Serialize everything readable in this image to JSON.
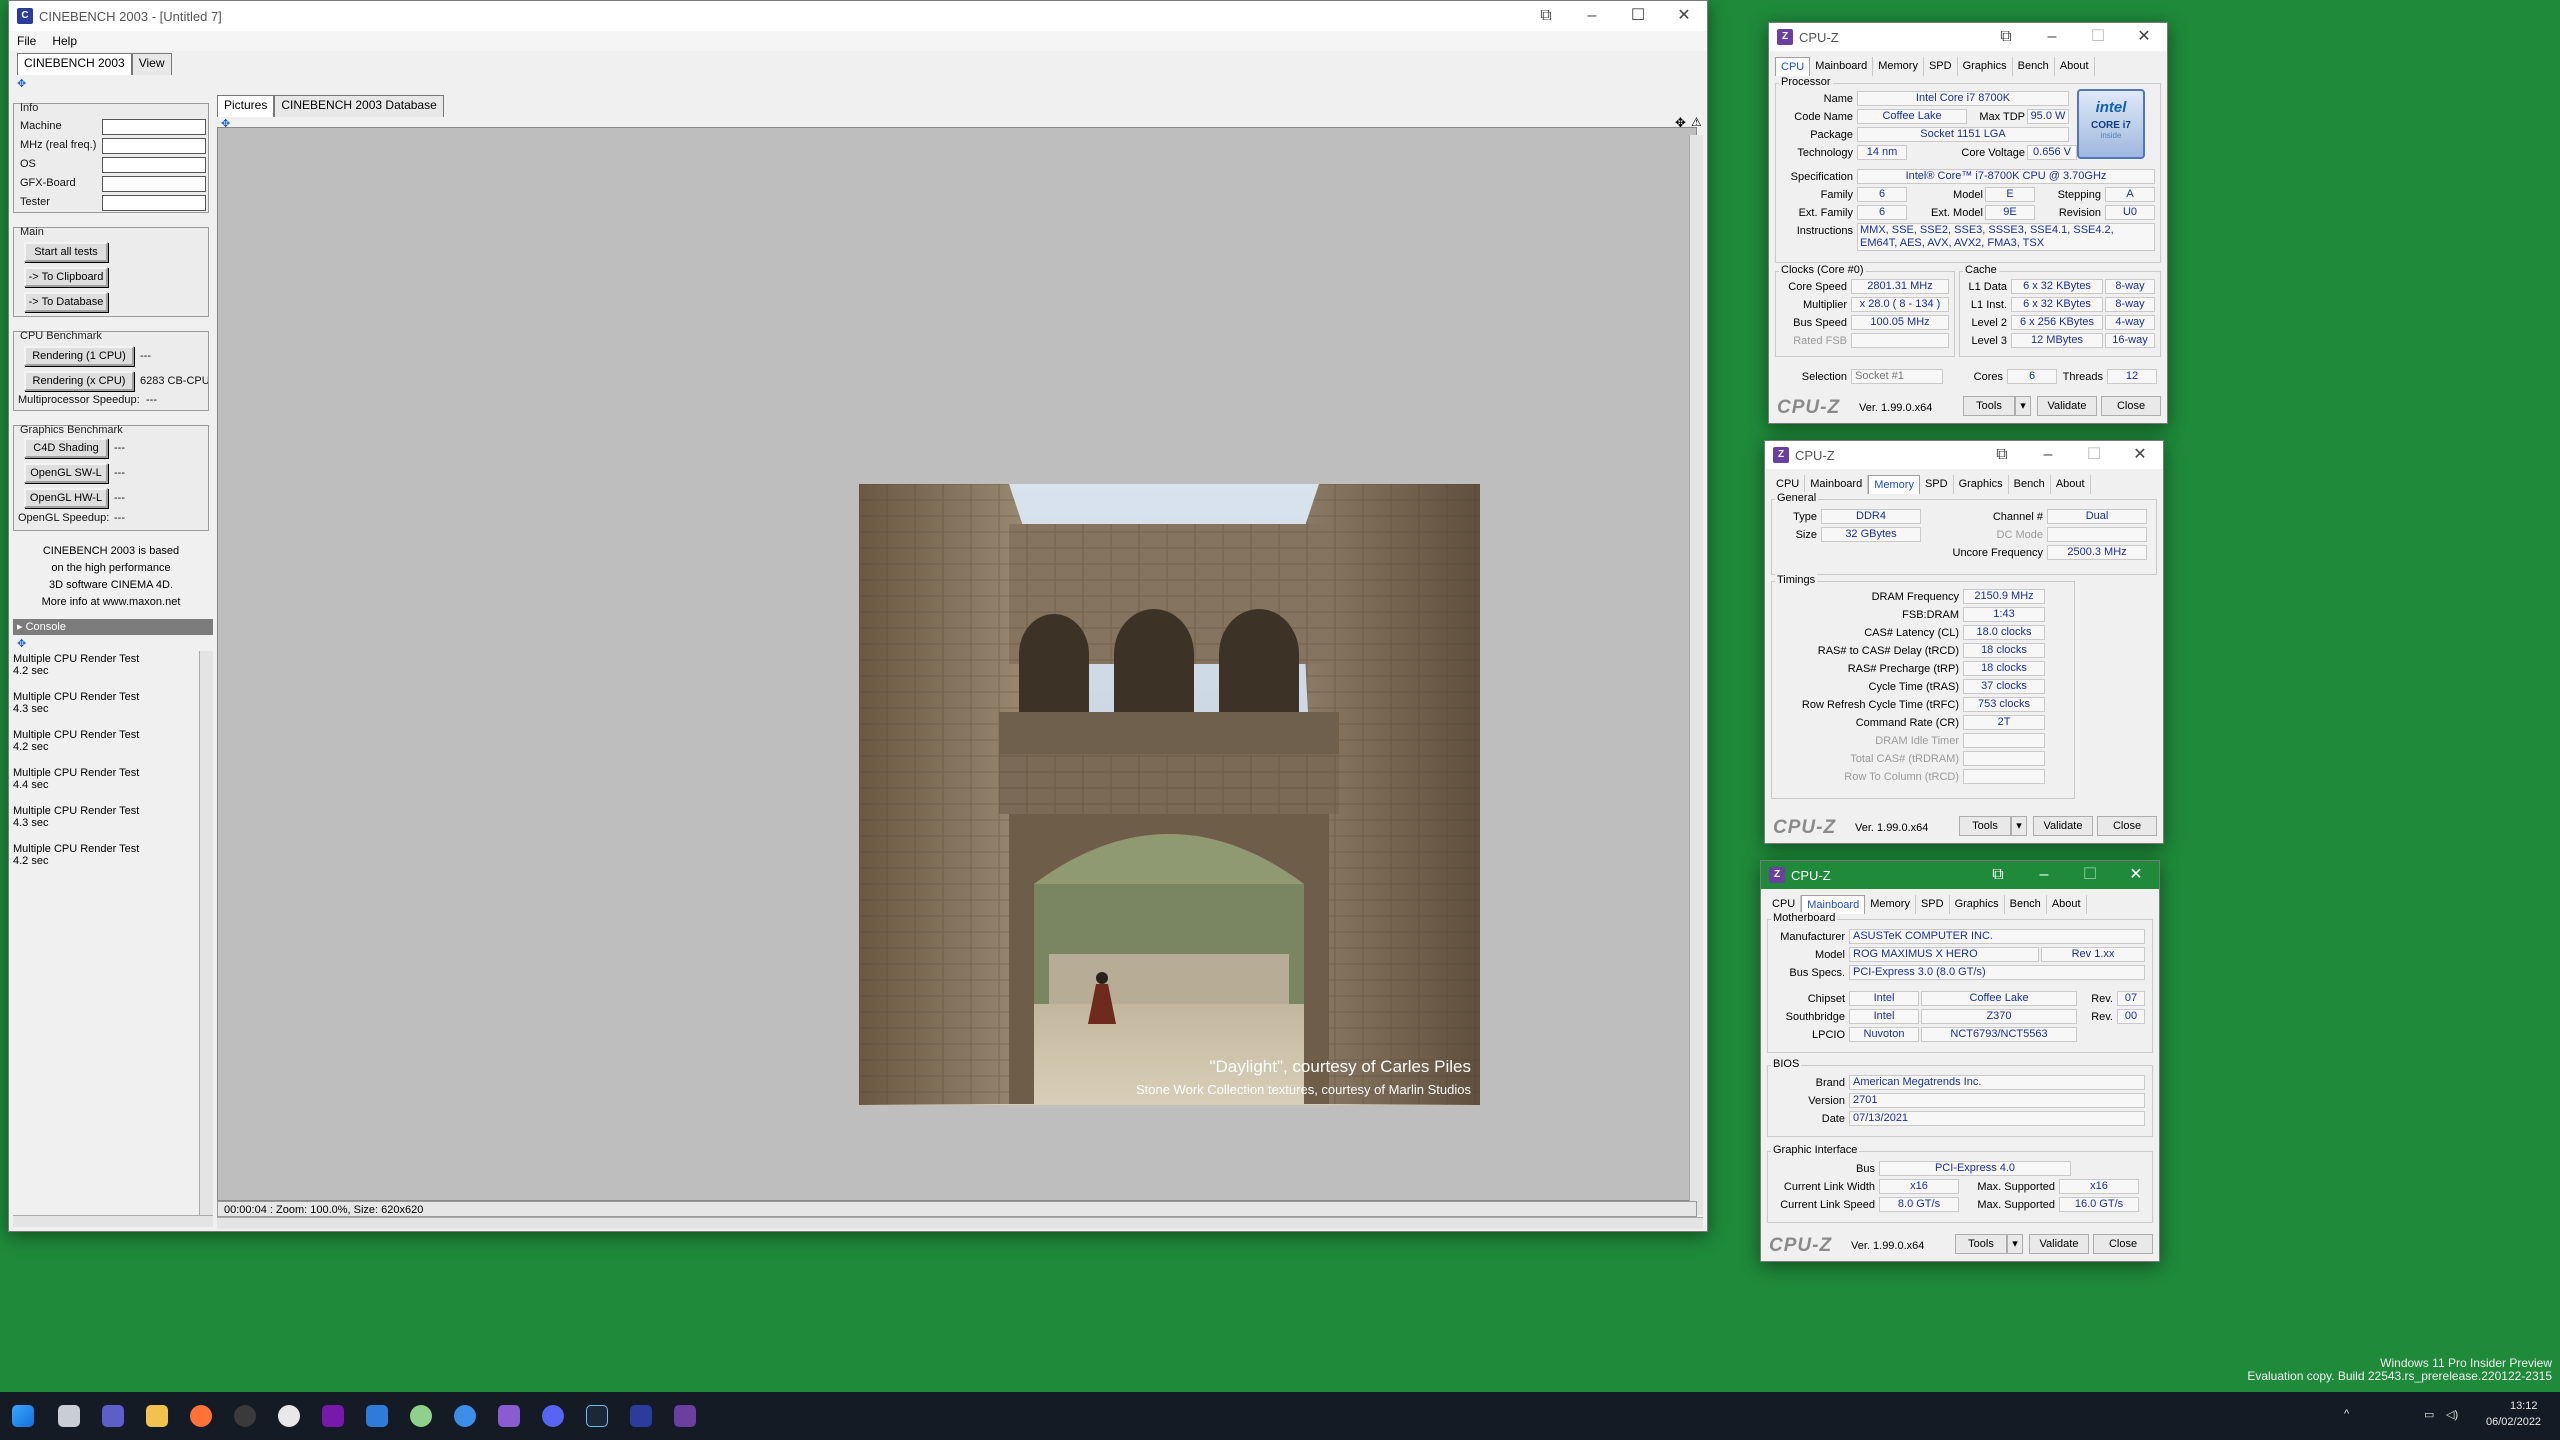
{
  "cinebench": {
    "title": "CINEBENCH 2003 - [Untitled 7]",
    "menu": [
      "File",
      "Help"
    ],
    "tabs": [
      "CINEBENCH 2003",
      "View"
    ],
    "info": {
      "label": "Info",
      "fields": [
        "Machine",
        "MHz (real freq.)",
        "OS",
        "GFX-Board",
        "Tester"
      ]
    },
    "main": {
      "label": "Main",
      "start": "Start all tests",
      "clipboard": "-> To Clipboard",
      "database": "-> To Database"
    },
    "cpu_bench": {
      "label": "CPU Benchmark",
      "r1": "Rendering (1 CPU)",
      "r1_val": "---",
      "rx": "Rendering (x CPU)",
      "rx_val": "6283 CB-CPU",
      "speedup_label": "Multiprocessor Speedup:",
      "speedup_val": "---"
    },
    "gfx_bench": {
      "label": "Graphics Benchmark",
      "c4d": "C4D Shading",
      "c4d_val": "---",
      "swl": "OpenGL SW-L",
      "swl_val": "---",
      "hwl": "OpenGL HW-L",
      "hwl_val": "---",
      "speedup_label": "OpenGL Speedup:",
      "speedup_val": "---"
    },
    "about": [
      "CINEBENCH 2003 is based",
      "on the high performance",
      "3D software CINEMA 4D.",
      "More info at www.maxon.net"
    ],
    "console_label": "Console",
    "log": [
      {
        "t": "Multiple CPU Render Test",
        "s": "4.2 sec"
      },
      {
        "t": "Multiple CPU Render Test",
        "s": "4.3 sec"
      },
      {
        "t": "Multiple CPU Render Test",
        "s": "4.2 sec"
      },
      {
        "t": "Multiple CPU Render Test",
        "s": "4.4 sec"
      },
      {
        "t": "Multiple CPU Render Test",
        "s": "4.3 sec"
      },
      {
        "t": "Multiple CPU Render Test",
        "s": "4.2 sec"
      }
    ],
    "view_tabs": [
      "Pictures",
      "CINEBENCH 2003 Database"
    ],
    "caption1": "\"Daylight\", courtesy of Carles Piles",
    "caption2": "Stone Work Collection textures, courtesy of Marlin Studios",
    "status": "00:00:04 : Zoom: 100.0%, Size: 620x620"
  },
  "cpuz_common": {
    "title": "CPU-Z",
    "tabs": [
      "CPU",
      "Mainboard",
      "Memory",
      "SPD",
      "Graphics",
      "Bench",
      "About"
    ],
    "logo": "CPU-Z",
    "version": "Ver. 1.99.0.x64",
    "tools": "Tools",
    "validate": "Validate",
    "close": "Close"
  },
  "cpu": {
    "processor_label": "Processor",
    "name": "Intel Core i7 8700K",
    "code_name": "Coffee Lake",
    "max_tdp": "95.0 W",
    "package": "Socket 1151 LGA",
    "technology": "14 nm",
    "core_voltage": "0.656 V",
    "specification": "Intel® Core™ i7-8700K CPU @ 3.70GHz",
    "family": "6",
    "model": "E",
    "stepping": "A",
    "ext_family": "6",
    "ext_model": "9E",
    "revision": "U0",
    "instructions": "MMX, SSE, SSE2, SSE3, SSSE3, SSE4.1, SSE4.2, EM64T, AES, AVX, AVX2, FMA3, TSX",
    "clocks_label": "Clocks (Core #0)",
    "core_speed": "2801.31 MHz",
    "multiplier": "x 28.0 ( 8 - 134 )",
    "bus_speed": "100.05 MHz",
    "rated_fsb": "",
    "cache_label": "Cache",
    "l1d": "6 x 32 KBytes",
    "l1d_w": "8-way",
    "l1i": "6 x 32 KBytes",
    "l1i_w": "8-way",
    "l2": "6 x 256 KBytes",
    "l2_w": "4-way",
    "l3": "12 MBytes",
    "l3_w": "16-way",
    "selection": "Socket #1",
    "cores": "6",
    "threads": "12",
    "badge": [
      "intel",
      "CORE i7",
      "inside"
    ],
    "keys": {
      "name": "Name",
      "code_name": "Code Name",
      "max_tdp": "Max TDP",
      "package": "Package",
      "technology": "Technology",
      "core_voltage": "Core Voltage",
      "specification": "Specification",
      "family": "Family",
      "model": "Model",
      "stepping": "Stepping",
      "ext_family": "Ext. Family",
      "ext_model": "Ext. Model",
      "revision": "Revision",
      "instructions": "Instructions",
      "core_speed": "Core Speed",
      "multiplier": "Multiplier",
      "bus_speed": "Bus Speed",
      "rated_fsb": "Rated FSB",
      "l1d": "L1 Data",
      "l1i": "L1 Inst.",
      "l2": "Level 2",
      "l3": "Level 3",
      "selection": "Selection",
      "cores": "Cores",
      "threads": "Threads"
    }
  },
  "memory": {
    "general_label": "General",
    "type": "DDR4",
    "size": "32 GBytes",
    "channel": "Dual",
    "dc_mode": "",
    "uncore": "2500.3 MHz",
    "timings_label": "Timings",
    "dram_freq": "2150.9 MHz",
    "fsb_dram": "1:43",
    "cl": "18.0 clocks",
    "trcd": "18 clocks",
    "trp": "18 clocks",
    "tras": "37 clocks",
    "trfc": "753 clocks",
    "cr": "2T",
    "keys": {
      "type": "Type",
      "size": "Size",
      "channel": "Channel #",
      "dc_mode": "DC Mode",
      "uncore": "Uncore Frequency",
      "dram_freq": "DRAM Frequency",
      "fsb_dram": "FSB:DRAM",
      "cl": "CAS# Latency (CL)",
      "trcd": "RAS# to CAS# Delay (tRCD)",
      "trp": "RAS# Precharge (tRP)",
      "tras": "Cycle Time (tRAS)",
      "trfc": "Row Refresh Cycle Time (tRFC)",
      "cr": "Command Rate (CR)",
      "idle": "DRAM Idle Timer",
      "trdram": "Total CAS# (tRDRAM)",
      "trcd2": "Row To Column (tRCD)"
    }
  },
  "mainboard": {
    "mb_label": "Motherboard",
    "manufacturer": "ASUSTeK COMPUTER INC.",
    "model": "ROG MAXIMUS X HERO",
    "model_rev": "Rev 1.xx",
    "bus_specs": "PCI-Express 3.0 (8.0 GT/s)",
    "chipset": "Intel",
    "chipset_name": "Coffee Lake",
    "chipset_rev": "07",
    "southbridge": "Intel",
    "southbridge_name": "Z370",
    "southbridge_rev": "00",
    "lpcio": "Nuvoton",
    "lpcio_name": "NCT6793/NCT5563",
    "bios_label": "BIOS",
    "brand": "American Megatrends Inc.",
    "version": "2701",
    "date": "07/13/2021",
    "gi_label": "Graphic Interface",
    "gi_bus": "PCI-Express 4.0",
    "link_width": "x16",
    "max_width": "x16",
    "link_speed": "8.0 GT/s",
    "max_speed": "16.0 GT/s",
    "keys": {
      "manufacturer": "Manufacturer",
      "model": "Model",
      "bus_specs": "Bus Specs.",
      "chipset": "Chipset",
      "southbridge": "Southbridge",
      "lpcio": "LPCIO",
      "rev": "Rev.",
      "brand": "Brand",
      "version": "Version",
      "date": "Date",
      "bus": "Bus",
      "link_width": "Current Link Width",
      "max_supported": "Max. Supported",
      "link_speed": "Current Link Speed"
    }
  },
  "desktop": {
    "watermark1": "Windows 11 Pro Insider Preview",
    "watermark2": "Evaluation copy. Build 22543.rs_prerelease.220122-2315",
    "time": "13:12",
    "date": "06/02/2022"
  }
}
